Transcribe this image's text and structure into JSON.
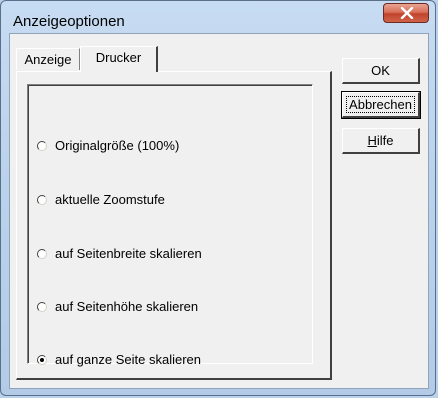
{
  "window": {
    "title": "Anzeigeoptionen",
    "close_icon": "close-icon"
  },
  "tabs": [
    {
      "label": "Anzeige",
      "selected": false
    },
    {
      "label": "Drucker",
      "selected": true
    }
  ],
  "options": [
    {
      "label": "Originalgröße (100%)",
      "checked": false
    },
    {
      "label": "aktuelle Zoomstufe",
      "checked": false
    },
    {
      "label": "auf Seitenbreite skalieren",
      "checked": false
    },
    {
      "label": "auf Seitenhöhe skalieren",
      "checked": false
    },
    {
      "label": "auf ganze Seite skalieren",
      "checked": true
    }
  ],
  "buttons": {
    "ok": "OK",
    "cancel": "Abbrechen",
    "help_prefix": "",
    "help_underline": "H",
    "help_rest": "ilfe"
  }
}
